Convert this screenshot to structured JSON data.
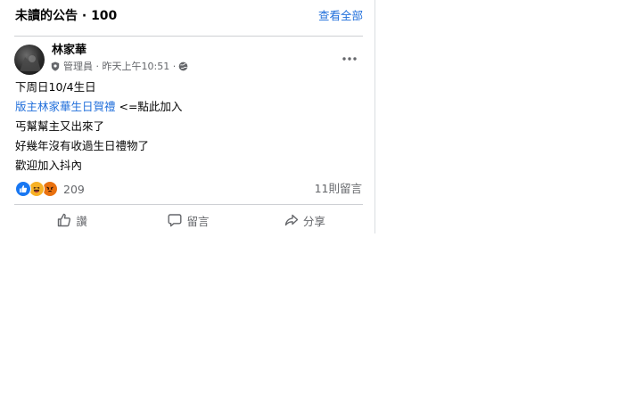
{
  "announcements": {
    "title": "未讀的公告 · 100",
    "see_all": "查看全部"
  },
  "post": {
    "author": "林家華",
    "role": "管理員",
    "meta_time": "昨天上午10:51",
    "meta_sep": "·",
    "lines": [
      "下周日10/4生日",
      "丐幫幫主又出來了",
      "好幾年沒有收過生日禮物了",
      "歡迎加入抖內"
    ],
    "link_text": "版主林家華生日賀禮",
    "link_suffix": " <=點此加入",
    "reaction_count": "209",
    "comments_count": "11則留言",
    "reactions": [
      "like-reaction-icon",
      "haha-reaction-icon",
      "angry-reaction-icon"
    ]
  },
  "actions": {
    "like": "讚",
    "comment": "留言",
    "share": "分享"
  },
  "colors": {
    "accent": "#216fdb",
    "like": "#1877f2",
    "haha": "#f7b125",
    "angry": "#e9710f"
  }
}
